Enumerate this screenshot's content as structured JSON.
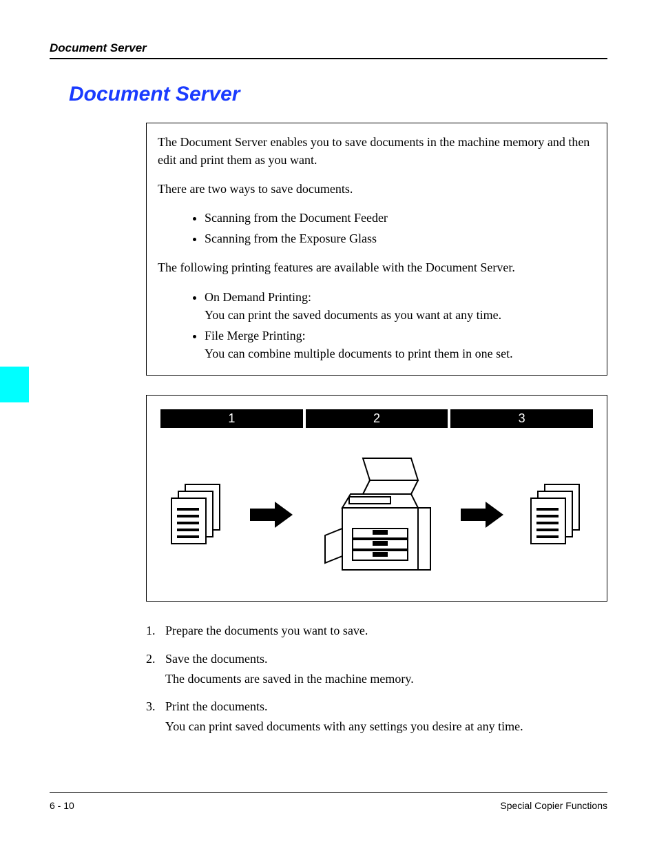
{
  "running_head": "Document Server",
  "title": "Document Server",
  "intro": {
    "p1": "The Document Server enables you to save documents in the machine memory and then edit and print them as you want.",
    "p2": "There are two ways to save documents.",
    "ways": [
      "Scanning from the Document Feeder",
      "Scanning from the Exposure Glass"
    ],
    "p3": "The following printing features are available with the Document Server.",
    "features": [
      {
        "name": "On Demand Printing:",
        "desc": "You can print the saved documents as you want at any time."
      },
      {
        "name": "File Merge Printing:",
        "desc": "You can combine multiple documents to print them in one set."
      }
    ]
  },
  "diagram": {
    "labels": [
      "1",
      "2",
      "3"
    ]
  },
  "steps": [
    {
      "n": "1.",
      "t": "Prepare the documents you want to save.",
      "sub": ""
    },
    {
      "n": "2.",
      "t": "Save the documents.",
      "sub": "The documents are saved in the machine memory."
    },
    {
      "n": "3.",
      "t": "Print the documents.",
      "sub": "You can print saved documents with any settings you desire at any time."
    }
  ],
  "footer": {
    "page": "6 - 10",
    "section": "Special Copier Functions"
  }
}
